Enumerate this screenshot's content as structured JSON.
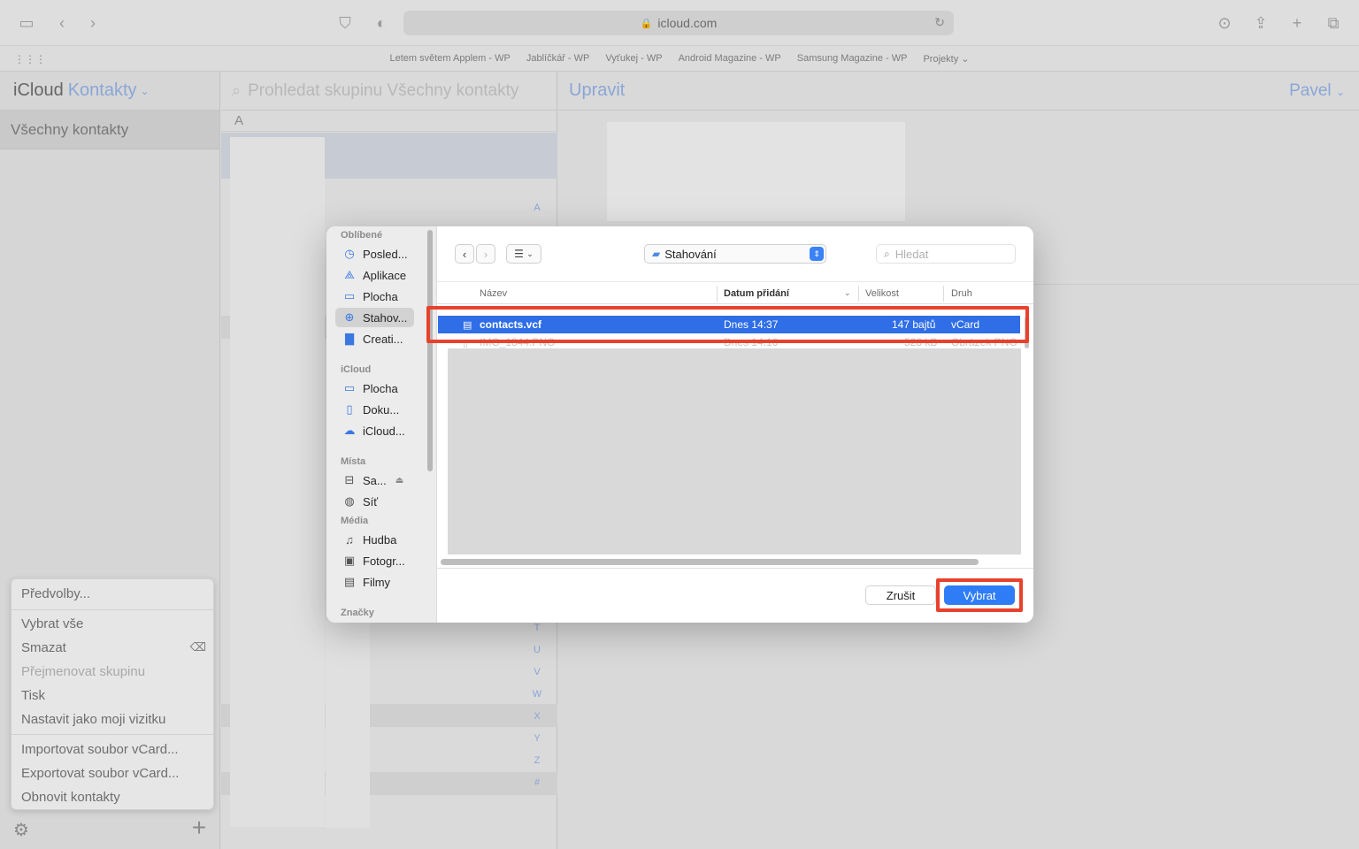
{
  "browser": {
    "url": "icloud.com",
    "favorites": [
      "Letem světem Applem - WP",
      "Jablíčkář - WP",
      "Vyťukej - WP",
      "Android Magazine - WP",
      "Samsung Magazine - WP",
      "Projekty"
    ]
  },
  "app": {
    "brand": "iCloud",
    "app_name": "Kontakty",
    "group_all": "Všechny kontakty",
    "search_placeholder": "Prohledat skupinu Všechny kontakty",
    "section_letter": "A",
    "edit_label": "Upravit",
    "user_name": "Pavel",
    "index_letters": [
      "A",
      "T",
      "U",
      "V",
      "W",
      "X",
      "Y",
      "Z",
      "#"
    ]
  },
  "context_menu": {
    "items": [
      {
        "label": "Předvolby...",
        "enabled": true
      },
      {
        "label": "Vybrat vše",
        "enabled": true
      },
      {
        "label": "Smazat",
        "enabled": true
      },
      {
        "label": "Přejmenovat skupinu",
        "enabled": false
      },
      {
        "label": "Tisk",
        "enabled": true
      },
      {
        "label": "Nastavit jako moji vizitku",
        "enabled": true
      },
      {
        "label": "Importovat soubor vCard...",
        "enabled": true
      },
      {
        "label": "Exportovat soubor vCard...",
        "enabled": true
      },
      {
        "label": "Obnovit kontakty",
        "enabled": true
      }
    ]
  },
  "dialog": {
    "sidebar": {
      "favorites_heading": "Oblíbené",
      "favorites": [
        "Posled...",
        "Aplikace",
        "Plocha",
        "Stahov...",
        "Creati..."
      ],
      "icloud_heading": "iCloud",
      "icloud": [
        "Plocha",
        "Doku...",
        "iCloud..."
      ],
      "places_heading": "Místa",
      "places": [
        "Sa...",
        "Síť"
      ],
      "media_heading": "Média",
      "media": [
        "Hudba",
        "Fotogr...",
        "Filmy"
      ],
      "tags_heading": "Značky"
    },
    "location": "Stahování",
    "search_placeholder": "Hledat",
    "columns": [
      "Název",
      "Datum přidání",
      "Velikost",
      "Druh"
    ],
    "files": [
      {
        "name": "contacts.vcf",
        "date": "Dnes 14:37",
        "size": "147 bajtů",
        "kind": "vCard",
        "selected": true
      },
      {
        "name": "IMG_1844.PNG",
        "date": "Dnes 14:10",
        "size": "528 kB",
        "kind": "Obrázek PNG",
        "selected": false
      }
    ],
    "cancel_label": "Zrušit",
    "choose_label": "Vybrat"
  }
}
